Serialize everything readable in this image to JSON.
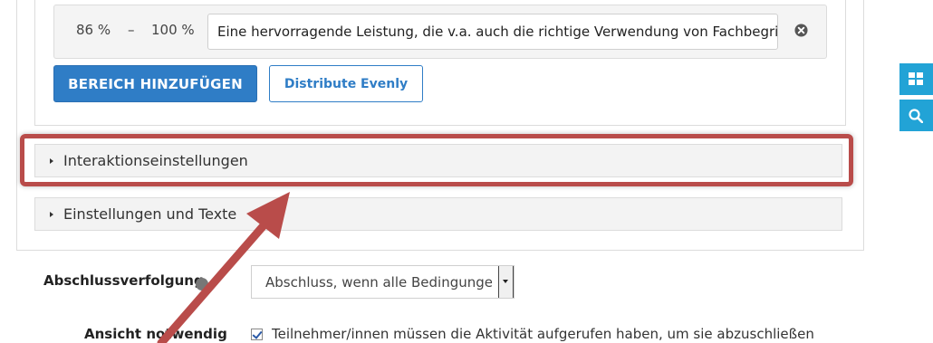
{
  "grade_range": {
    "from": "86 %",
    "separator": "–",
    "to": "100 %",
    "feedback_value": "Eine hervorragende Leistung, die v.a. auch die richtige Verwendung von Fachbegriffen ze"
  },
  "buttons": {
    "add_range": "BEREICH HINZUFÜGEN",
    "distribute_evenly": "Distribute Evenly"
  },
  "sections": [
    {
      "label": "Interaktionseinstellungen"
    },
    {
      "label": "Einstellungen und Texte"
    }
  ],
  "completion": {
    "label": "Abschlussverfolgung",
    "select_value": "Abschluss, wenn alle Bedingungen"
  },
  "view_required": {
    "label": "Ansicht notwendig",
    "checkbox_text": "Teilnehmer/innen müssen die Aktivität aufgerufen haben, um sie abzuschließen"
  },
  "side_toolbar": {
    "buttons": [
      {
        "icon": "grid-icon"
      },
      {
        "icon": "search-icon"
      }
    ]
  },
  "colors": {
    "primary": "#2f7dc6",
    "highlight": "#b94c4a",
    "side_accent": "#22a3d6"
  }
}
